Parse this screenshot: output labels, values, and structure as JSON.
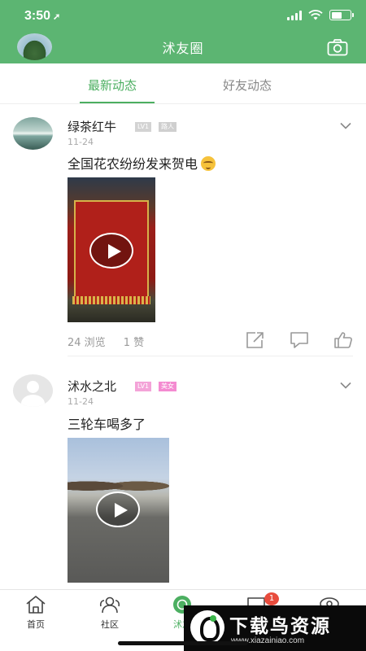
{
  "status_bar": {
    "time": "3:50",
    "location_glyph": "➚"
  },
  "header": {
    "title": "沭友圈",
    "camera_icon": "camera-icon",
    "accent": "#5cb572"
  },
  "tabs": [
    {
      "label": "最新动态",
      "active": true
    },
    {
      "label": "好友动态",
      "active": false
    }
  ],
  "posts": [
    {
      "user": "绿茶红牛",
      "level": "LV1",
      "tag": "路人",
      "date": "11-24",
      "text": "全国花农纷纷发来贺电",
      "views": "24 浏览",
      "likes": "1 赞"
    },
    {
      "user": "沭水之北",
      "level": "LV1",
      "tag": "美女",
      "date": "11-24",
      "text": "三轮车喝多了"
    }
  ],
  "nav": {
    "items": [
      {
        "label": "首页",
        "icon": "home-icon"
      },
      {
        "label": "社区",
        "icon": "community-icon"
      },
      {
        "label": "沭友",
        "icon": "friends-circle-icon",
        "active": true
      },
      {
        "label": "",
        "icon": "message-icon",
        "badge": "1"
      },
      {
        "label": "",
        "icon": "profile-icon"
      }
    ]
  },
  "watermark": {
    "title": "下载鸟资源",
    "url": "www.xiazainiao.com"
  }
}
